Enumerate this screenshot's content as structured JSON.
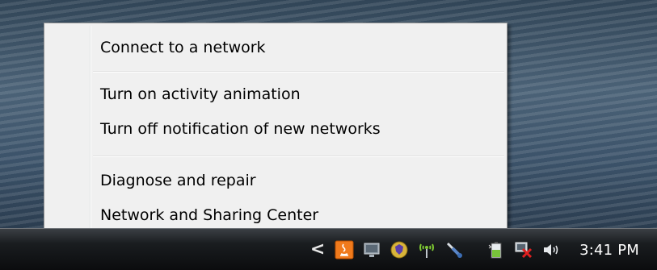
{
  "context_menu": {
    "items": [
      {
        "label": "Connect to a network"
      },
      {
        "label": "Turn on activity animation"
      },
      {
        "label": "Turn off notification of new networks"
      },
      {
        "label": "Diagnose and repair"
      },
      {
        "label": "Network and Sharing Center"
      }
    ]
  },
  "taskbar": {
    "tray": {
      "chevron": "<",
      "icons": [
        "java-update-icon",
        "monitor-network-icon",
        "security-shield-icon",
        "wireless-antenna-icon",
        "connection-plug-icon",
        "battery-power-icon",
        "network-disconnected-icon",
        "volume-icon"
      ]
    },
    "clock": "3:41 PM"
  }
}
